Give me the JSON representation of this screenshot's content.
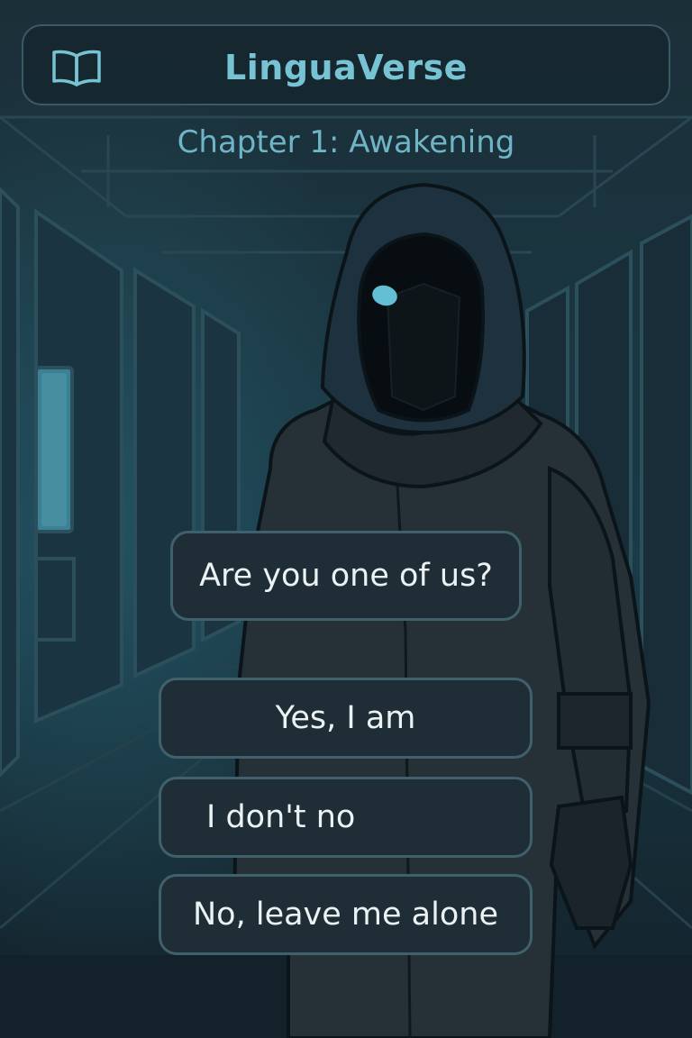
{
  "app": {
    "title": "LinguaVerse",
    "icon": "book-icon"
  },
  "chapter": {
    "title": "Chapter 1: Awakening"
  },
  "dialogue": {
    "question": "Are you one of us?",
    "choices": [
      {
        "label": "Yes, I am"
      },
      {
        "label": "I don't no"
      },
      {
        "label": "No, leave me alone"
      }
    ]
  },
  "colors": {
    "background": "#16262e",
    "accent": "#77c2d3",
    "bubble_bg": "#1e2d36",
    "bubble_border": "#40606c",
    "text": "#eaf2f4"
  }
}
